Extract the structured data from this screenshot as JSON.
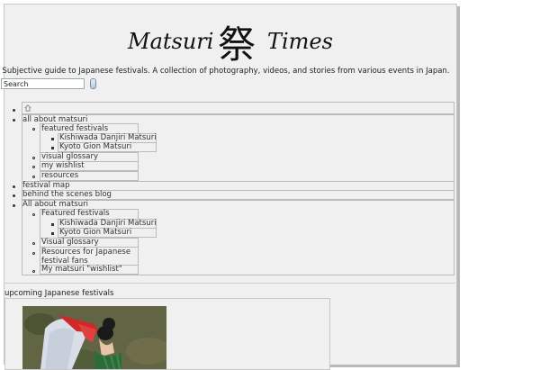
{
  "masthead": {
    "title_left": "Matsuri",
    "title_kanji": "祭",
    "title_right": "Times"
  },
  "tagline": "Subjective guide to Japanese festivals. A collection of photography, videos, and stories from various events in Japan.",
  "search": {
    "placeholder": "Search",
    "value": "Search"
  },
  "nav": {
    "home_icon": "home-icon",
    "menu1": {
      "label": "all about matsuri",
      "items": [
        {
          "label": "featured festivals",
          "children": [
            "Kishiwada Danjiri Matsuri",
            "Kyoto Gion Matsuri"
          ]
        },
        {
          "label": "visual glossary"
        },
        {
          "label": "my wishlist"
        },
        {
          "label": "resources"
        }
      ]
    },
    "festival_map": "festival map",
    "behind_scenes": "behind the scenes blog",
    "menu2": {
      "label": "All about matsuri",
      "items": [
        {
          "label": "Featured festivals",
          "children": [
            "Kishiwada Danjiri Matsuri",
            "Kyoto Gion Matsuri"
          ]
        },
        {
          "label": "Visual glossary"
        },
        {
          "label_line1": "Resources for Japanese",
          "label_line2": "festival fans"
        },
        {
          "label": "My matsuri \"wishlist\""
        }
      ]
    }
  },
  "upcoming": {
    "heading": "upcoming Japanese festivals"
  },
  "colors": {
    "page_bg": "#f0f0f0",
    "border": "#bbbbbb",
    "text": "#333333"
  }
}
